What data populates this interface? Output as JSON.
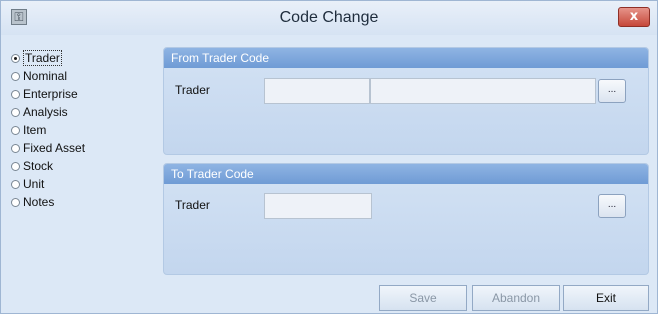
{
  "window": {
    "title": "Code Change",
    "icon": "app-key-icon",
    "close_symbol": "x"
  },
  "radio_options": [
    {
      "label": "Trader",
      "selected": true
    },
    {
      "label": "Nominal",
      "selected": false
    },
    {
      "label": "Enterprise",
      "selected": false
    },
    {
      "label": "Analysis",
      "selected": false
    },
    {
      "label": "Item",
      "selected": false
    },
    {
      "label": "Fixed Asset",
      "selected": false
    },
    {
      "label": "Stock",
      "selected": false
    },
    {
      "label": "Unit",
      "selected": false
    },
    {
      "label": "Notes",
      "selected": false
    }
  ],
  "from_group": {
    "header": "From Trader Code",
    "field_label": "Trader",
    "code_value": "",
    "name_value": "",
    "browse_label": "..."
  },
  "to_group": {
    "header": "To Trader Code",
    "field_label": "Trader",
    "code_value": "",
    "browse_label": "..."
  },
  "buttons": {
    "save": "Save",
    "abandon": "Abandon",
    "exit": "Exit"
  },
  "colors": {
    "window_bg": "#dce8f6",
    "group_header": "#7ba5dc",
    "close_button": "#c6483a"
  }
}
